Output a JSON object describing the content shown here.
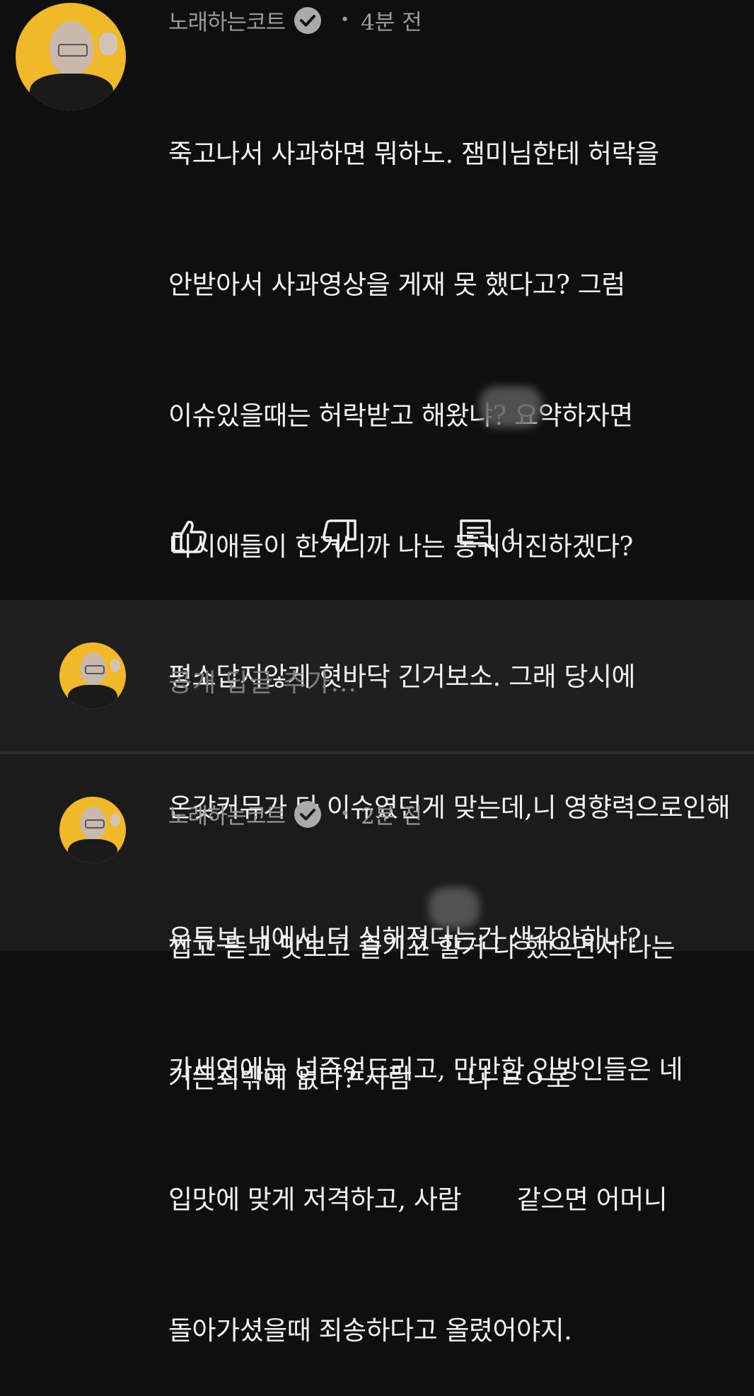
{
  "comment1": {
    "author": "노래하는코트",
    "time": "4분 전",
    "lines": [
      "죽고나서 사과하면 뭐하노. 잼미님한테 허락을",
      "안받아서 사과영상을 게재 못 했다고? 그럼",
      "이슈있을때는 허락받고 해왔냐? 요약하자면",
      "디시애들이 한거니까 나는 동귀어진하겠다?",
      "평소답지않게 혓바닥 긴거보소. 그래 당시에",
      "온갖커뮤가 다 이슈였던게 맞는데,니 영향력으로인해",
      "유튜브 내에서 더 심해졌다는건 생각안하냐?",
      "가세연에는 넙죽엎드리고, 만만한 인방인들은 네",
      "입맛에 맞게 저격하고, 사람       같으면 어머니",
      "돌아가셨을때 죄송하다고 올렸어야지."
    ],
    "reply_count": "1"
  },
  "reply_box": {
    "placeholder": "공개 답글 추가..."
  },
  "comment2": {
    "author": "노래하는코트",
    "time": "2분 전",
    "lines": [
      "씹고 뜯고 맛보고 즐기고 할거 다 했으면서 나는",
      "거든죄밖에 없다? 사람       냐 ㄹㅇ로"
    ]
  },
  "icons": {
    "like": "thumbs-up-icon",
    "dislike": "thumbs-down-icon",
    "reply": "comment-icon",
    "verified": "verified-badge-icon"
  },
  "colors": {
    "background": "#0f0f0f",
    "reply_bg": "#1f1f20",
    "avatar": "#f0b927",
    "meta_text": "#9a9a9a"
  }
}
